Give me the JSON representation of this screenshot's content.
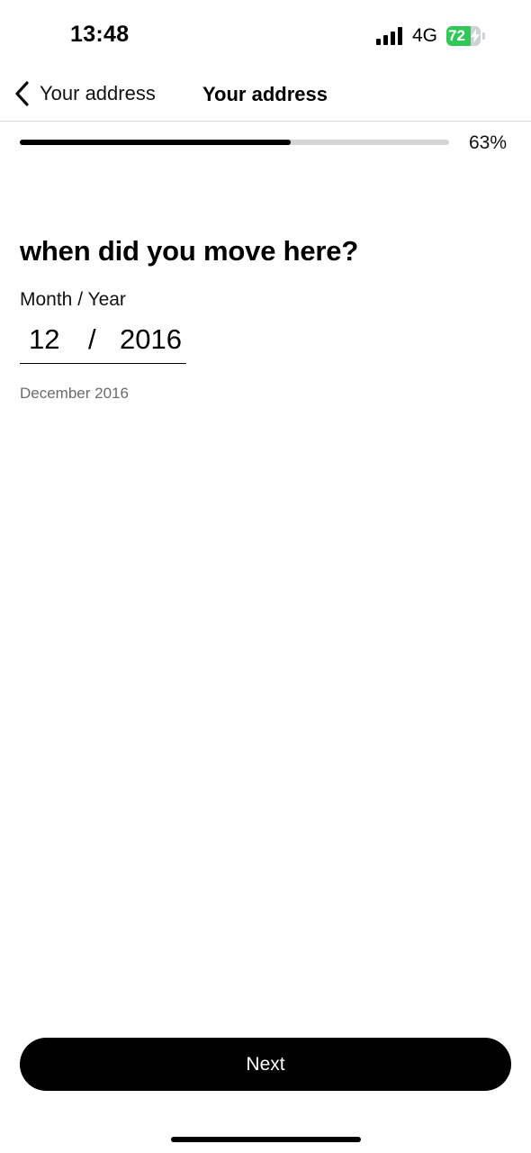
{
  "status_bar": {
    "time": "13:48",
    "network": "4G",
    "battery_level": "72",
    "battery_fraction": 0.72,
    "battery_color": "#33c759",
    "icons": [
      "signal-bars-icon",
      "battery-charging-icon"
    ]
  },
  "nav": {
    "back_label": "Your address",
    "title": "Your address",
    "back_icon": "chevron-left-icon"
  },
  "progress": {
    "value": 0.63,
    "label": "63%"
  },
  "question": {
    "title": "when did you move here?",
    "field_label": "Month / Year",
    "month_value": "12",
    "separator": "/",
    "year_value": "2016",
    "helper_text": "December 2016"
  },
  "footer": {
    "next_label": "Next"
  },
  "colors": {
    "accent": "#000000",
    "progress_track": "#d4d4d4",
    "helper_text": "#6b6b6b"
  }
}
